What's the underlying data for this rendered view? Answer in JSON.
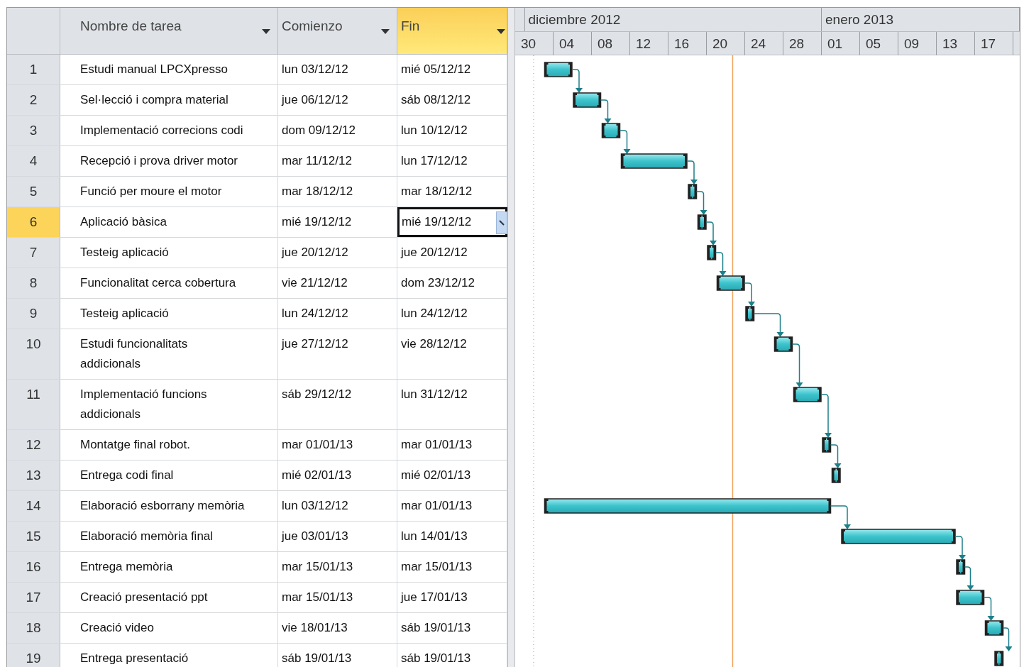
{
  "table": {
    "columns": [
      {
        "label": "Nombre de tarea",
        "selected": false
      },
      {
        "label": "Comienzo",
        "selected": false
      },
      {
        "label": "Fin",
        "selected": true
      }
    ],
    "rows": [
      {
        "id": "1",
        "name": "Estudi manual LPCXpresso",
        "start": "lun 03/12/12",
        "finish": "mié 05/12/12",
        "selected": false,
        "link_to_next": true
      },
      {
        "id": "2",
        "name": "Sel·lecció i compra material",
        "start": "jue 06/12/12",
        "finish": "sáb 08/12/12",
        "selected": false,
        "link_to_next": true
      },
      {
        "id": "3",
        "name": "Implementació correcions codi",
        "start": "dom 09/12/12",
        "finish": "lun 10/12/12",
        "selected": false,
        "link_to_next": true
      },
      {
        "id": "4",
        "name": "Recepció i prova driver motor",
        "start": "mar 11/12/12",
        "finish": "lun 17/12/12",
        "selected": false,
        "link_to_next": true
      },
      {
        "id": "5",
        "name": "Funció per moure el motor",
        "start": "mar 18/12/12",
        "finish": "mar 18/12/12",
        "selected": false,
        "link_to_next": true
      },
      {
        "id": "6",
        "name": "Aplicació bàsica",
        "start": "mié 19/12/12",
        "finish": "mié 19/12/12",
        "selected": true,
        "link_to_next": true
      },
      {
        "id": "7",
        "name": "Testeig aplicació",
        "start": "jue 20/12/12",
        "finish": "jue 20/12/12",
        "selected": false,
        "link_to_next": true
      },
      {
        "id": "8",
        "name": "Funcionalitat cerca cobertura",
        "start": "vie 21/12/12",
        "finish": "dom 23/12/12",
        "selected": false,
        "link_to_next": true
      },
      {
        "id": "9",
        "name": "Testeig aplicació",
        "start": "lun 24/12/12",
        "finish": "lun 24/12/12",
        "selected": false,
        "link_to_next": true
      },
      {
        "id": "10",
        "name": "Estudi funcionalitats\naddicionals",
        "start": "jue 27/12/12",
        "finish": "vie 28/12/12",
        "selected": false,
        "link_to_next": true
      },
      {
        "id": "11",
        "name": "Implementació funcions\naddicionals",
        "start": "sáb 29/12/12",
        "finish": "lun 31/12/12",
        "selected": false,
        "link_to_next": true
      },
      {
        "id": "12",
        "name": "Montatge final robot.",
        "start": "mar 01/01/13",
        "finish": "mar 01/01/13",
        "selected": false,
        "link_to_next": true
      },
      {
        "id": "13",
        "name": "Entrega codi final",
        "start": "mié 02/01/13",
        "finish": "mié 02/01/13",
        "selected": false,
        "link_to_next": false
      },
      {
        "id": "14",
        "name": "Elaboració esborrany memòria",
        "start": "lun 03/12/12",
        "finish": "mar 01/01/13",
        "selected": false,
        "link_to_next": true
      },
      {
        "id": "15",
        "name": "Elaboració memòria final",
        "start": "jue 03/01/13",
        "finish": "lun 14/01/13",
        "selected": false,
        "link_to_next": true
      },
      {
        "id": "16",
        "name": "Entrega memòria",
        "start": "mar 15/01/13",
        "finish": "mar 15/01/13",
        "selected": false,
        "link_to_next": true
      },
      {
        "id": "17",
        "name": "Creació presentació ppt",
        "start": "mar 15/01/13",
        "finish": "jue 17/01/13",
        "selected": false,
        "link_to_next": true
      },
      {
        "id": "18",
        "name": "Creació video",
        "start": "vie 18/01/13",
        "finish": "sáb 19/01/13",
        "selected": false,
        "link_to_next": true
      },
      {
        "id": "19",
        "name": "Entrega presentació",
        "start": "sáb 19/01/13",
        "finish": "sáb 19/01/13",
        "selected": false,
        "link_to_next": false
      }
    ]
  },
  "timescale": {
    "months": [
      {
        "label": "diciembre 2012"
      },
      {
        "label": "enero 2013"
      }
    ],
    "days": [
      {
        "label": "30"
      },
      {
        "label": "04"
      },
      {
        "label": "08"
      },
      {
        "label": "12"
      },
      {
        "label": "16"
      },
      {
        "label": "20"
      },
      {
        "label": "24"
      },
      {
        "label": "28"
      },
      {
        "label": "01"
      },
      {
        "label": "05"
      },
      {
        "label": "09"
      },
      {
        "label": "13"
      },
      {
        "label": "17"
      }
    ]
  }
}
